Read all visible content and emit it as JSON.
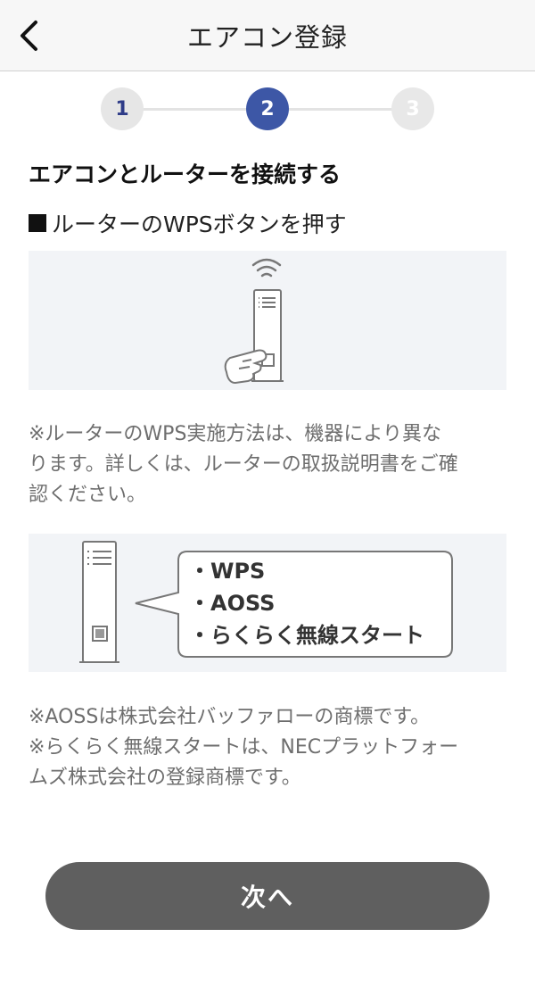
{
  "header": {
    "title": "エアコン登録",
    "back_icon": "chevron-left-icon"
  },
  "stepper": {
    "steps": [
      {
        "label": "1",
        "state": "done"
      },
      {
        "label": "2",
        "state": "current"
      },
      {
        "label": "3",
        "state": "upcoming"
      }
    ],
    "active_color": "#3d57a6"
  },
  "main": {
    "section_title": "エアコンとルーターを接続する",
    "sub_title_mark": "■",
    "sub_title": "ルーターのWPSボタンを押す",
    "note1_lines": [
      "※ルーターのWPS実施方法は、機器により異な",
      "ります。詳しくは、ルーターの取扱説明書をご確",
      "認ください。"
    ],
    "bubble_items": [
      "・WPS",
      "・AOSS",
      "・らくらく無線スタート"
    ],
    "note2_lines": [
      "※AOSSは株式会社バッファローの商標です。",
      "※らくらく無線スタートは、NECプラットフォー",
      "ムズ株式会社の登録商標です。"
    ]
  },
  "footer": {
    "next_label": "次へ",
    "button_color": "#5f5f5f"
  }
}
